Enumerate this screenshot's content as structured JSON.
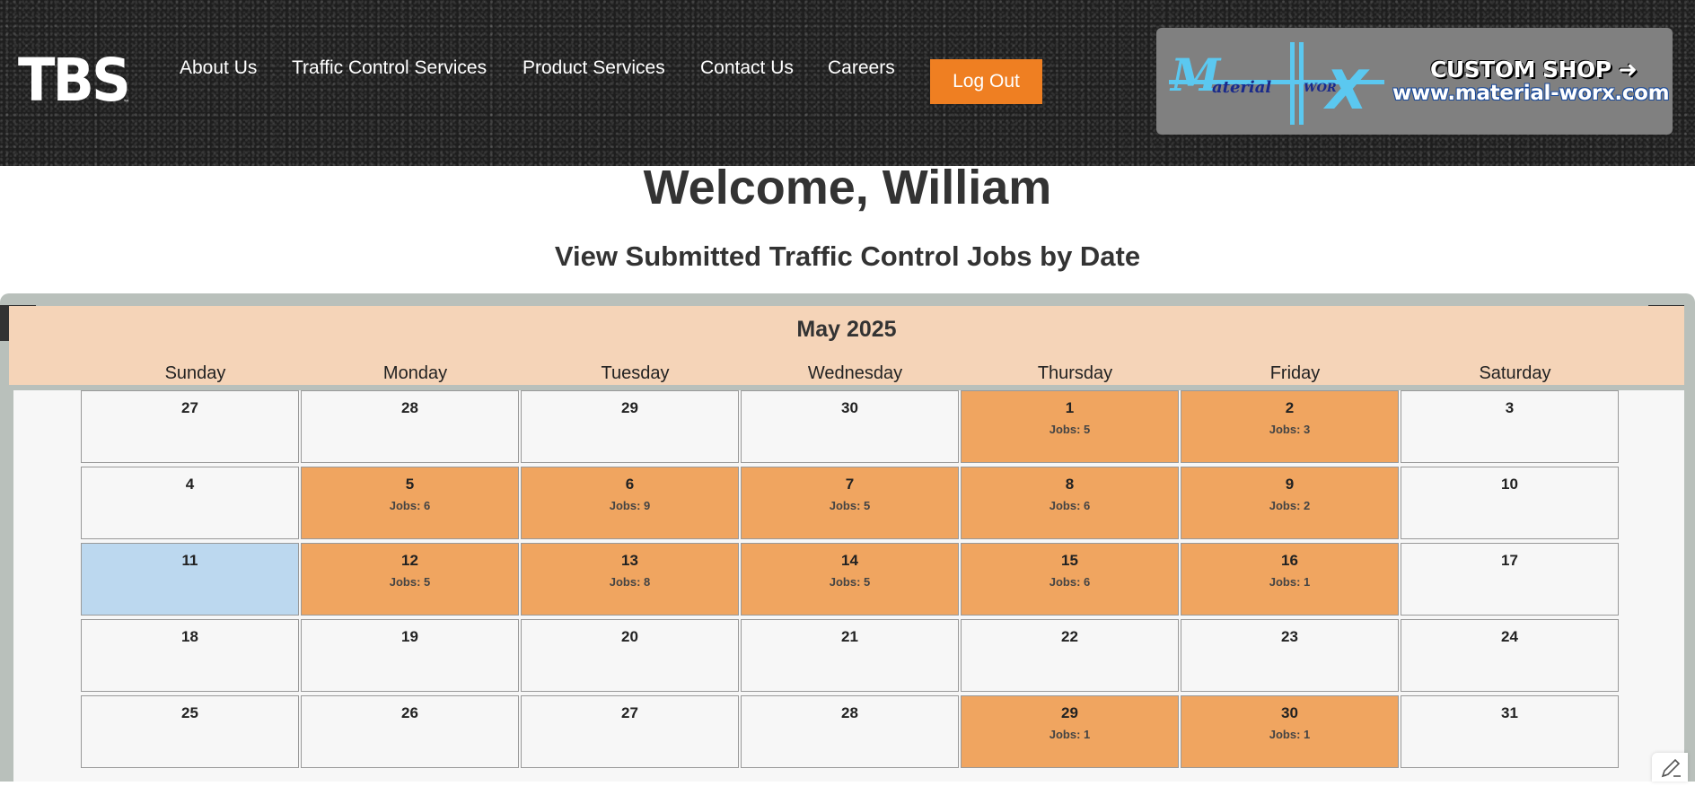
{
  "header": {
    "logo_text": "TBS",
    "logo_tm": "™",
    "nav": [
      {
        "label": "About Us"
      },
      {
        "label": "Traffic Control Services"
      },
      {
        "label": "Product Services"
      },
      {
        "label": "Contact Us"
      },
      {
        "label": "Careers"
      }
    ],
    "logout_label": "Log Out",
    "ad": {
      "logo_m": "M",
      "logo_aterial": "aterial",
      "logo_wor": "WOR",
      "logo_x": "X",
      "shop_label": "CUSTOM SHOP ➜",
      "url": "www.material-worx.com",
      "accent_color": "#5bc8f0"
    }
  },
  "welcome": "Welcome, William",
  "subtitle": "View Submitted Traffic Control Jobs by Date",
  "calendar": {
    "month_title": "May 2025",
    "prev_icon": "‹",
    "next_icon": "›",
    "weekdays": [
      "Sunday",
      "Monday",
      "Tuesday",
      "Wednesday",
      "Thursday",
      "Friday",
      "Saturday"
    ],
    "weeks": [
      [
        {
          "day": "27",
          "jobs": ""
        },
        {
          "day": "28",
          "jobs": ""
        },
        {
          "day": "29",
          "jobs": ""
        },
        {
          "day": "30",
          "jobs": ""
        },
        {
          "day": "1",
          "jobs": "Jobs: 5"
        },
        {
          "day": "2",
          "jobs": "Jobs: 3"
        },
        {
          "day": "3",
          "jobs": ""
        }
      ],
      [
        {
          "day": "4",
          "jobs": ""
        },
        {
          "day": "5",
          "jobs": "Jobs: 6"
        },
        {
          "day": "6",
          "jobs": "Jobs: 9"
        },
        {
          "day": "7",
          "jobs": "Jobs: 5"
        },
        {
          "day": "8",
          "jobs": "Jobs: 6"
        },
        {
          "day": "9",
          "jobs": "Jobs: 2"
        },
        {
          "day": "10",
          "jobs": ""
        }
      ],
      [
        {
          "day": "11",
          "jobs": "",
          "today": true
        },
        {
          "day": "12",
          "jobs": "Jobs: 5"
        },
        {
          "day": "13",
          "jobs": "Jobs: 8"
        },
        {
          "day": "14",
          "jobs": "Jobs: 5"
        },
        {
          "day": "15",
          "jobs": "Jobs: 6"
        },
        {
          "day": "16",
          "jobs": "Jobs: 1"
        },
        {
          "day": "17",
          "jobs": ""
        }
      ],
      [
        {
          "day": "18",
          "jobs": ""
        },
        {
          "day": "19",
          "jobs": ""
        },
        {
          "day": "20",
          "jobs": ""
        },
        {
          "day": "21",
          "jobs": ""
        },
        {
          "day": "22",
          "jobs": ""
        },
        {
          "day": "23",
          "jobs": ""
        },
        {
          "day": "24",
          "jobs": ""
        }
      ],
      [
        {
          "day": "25",
          "jobs": ""
        },
        {
          "day": "26",
          "jobs": ""
        },
        {
          "day": "27",
          "jobs": ""
        },
        {
          "day": "28",
          "jobs": ""
        },
        {
          "day": "29",
          "jobs": "Jobs: 1"
        },
        {
          "day": "30",
          "jobs": "Jobs: 1"
        },
        {
          "day": "31",
          "jobs": ""
        }
      ]
    ],
    "colors": {
      "job_day": "#f0a560",
      "today": "#bcd8ef",
      "empty_day": "#f7f7f7",
      "header_bg": "#f5d4b8"
    }
  },
  "corner_icon": "edit-pen-icon"
}
